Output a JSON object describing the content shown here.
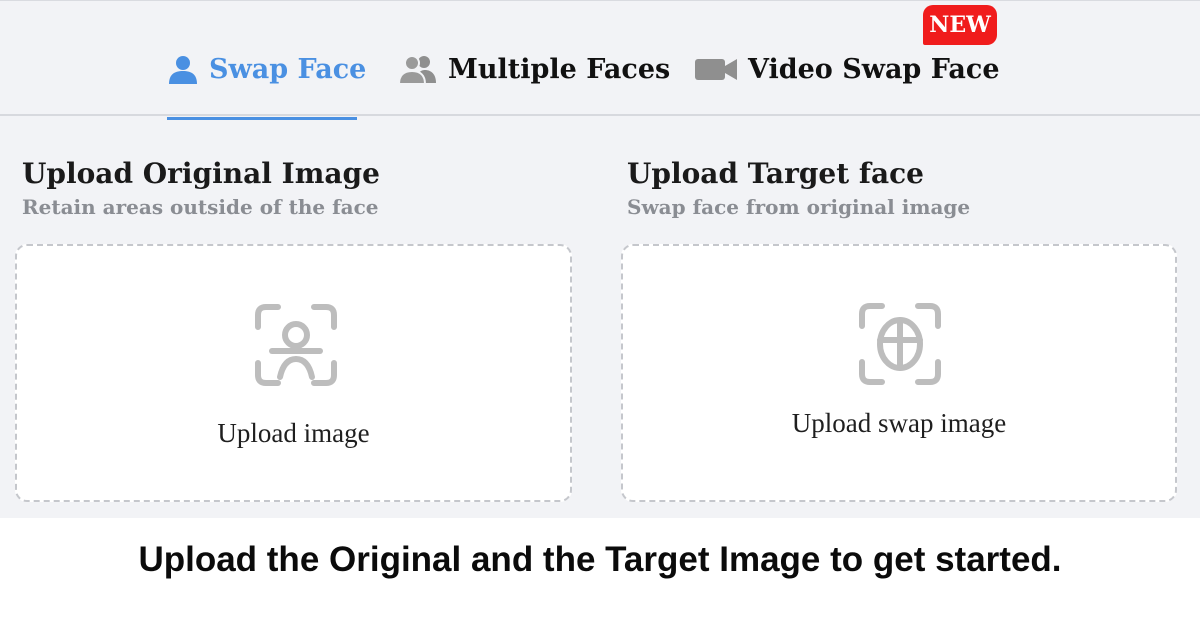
{
  "tabs": [
    {
      "label": "Swap Face",
      "icon": "user-icon",
      "active": true
    },
    {
      "label": "Multiple Faces",
      "icon": "users-icon",
      "active": false
    },
    {
      "label": "Video Swap Face",
      "icon": "video-camera-icon",
      "active": false
    }
  ],
  "badge": {
    "text": "NEW"
  },
  "original": {
    "title": "Upload Original Image",
    "subtitle": "Retain areas outside of the face",
    "upload_label": "Upload image",
    "icon": "face-scan-icon"
  },
  "target": {
    "title": "Upload Target face",
    "subtitle": "Swap face from original image",
    "upload_label": "Upload swap image",
    "icon": "face-target-icon"
  },
  "caption": "Upload the Original and the Target Image to get started.",
  "colors": {
    "accent": "#4a90e2",
    "badge": "#f01c1c",
    "background": "#f2f3f6",
    "icon_gray": "#bdbdbd"
  }
}
